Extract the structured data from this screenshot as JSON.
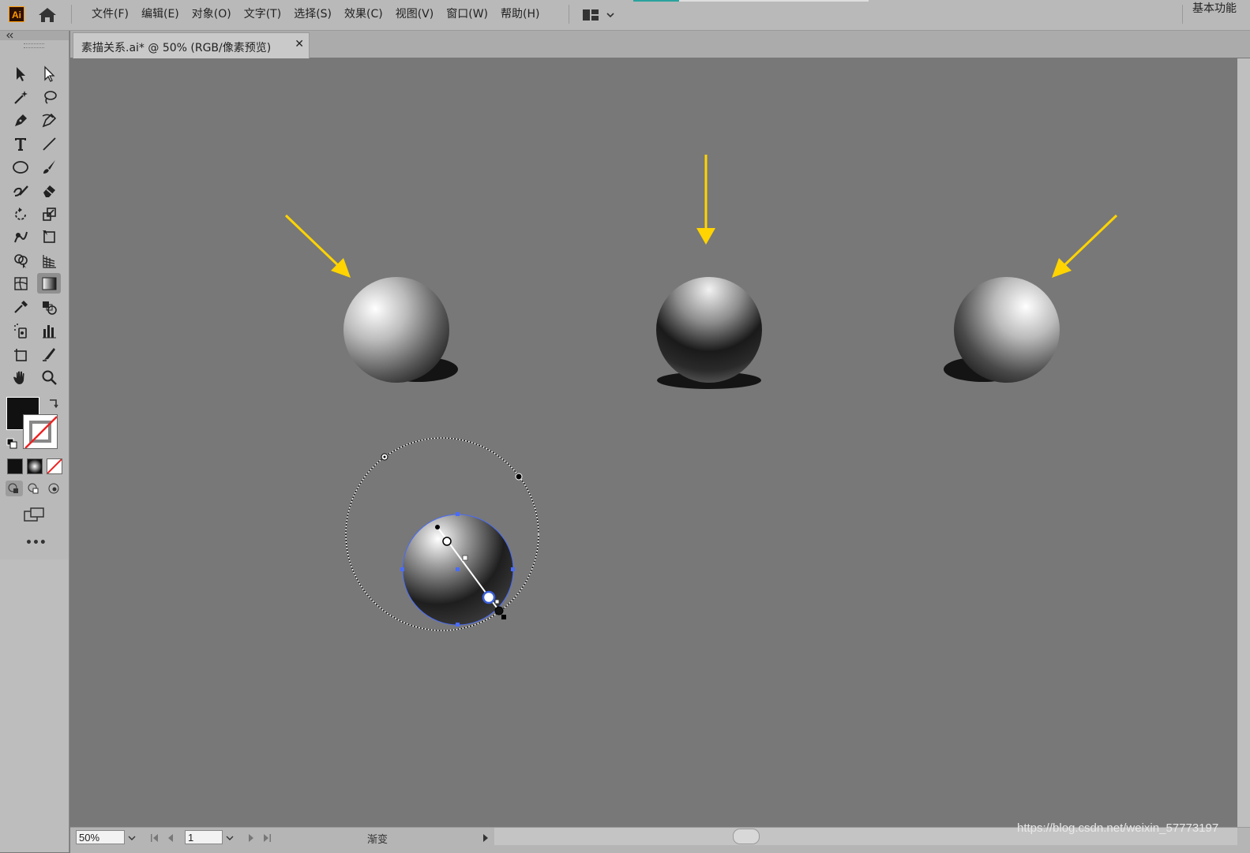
{
  "app": {
    "logo": "Ai",
    "menu": [
      "文件(F)",
      "编辑(E)",
      "对象(O)",
      "文字(T)",
      "选择(S)",
      "效果(C)",
      "视图(V)",
      "窗口(W)",
      "帮助(H)"
    ],
    "workspace_label": "基本功能"
  },
  "document": {
    "tab_title": "素描关系.ai* @ 50% (RGB/像素预览)",
    "close": "✕"
  },
  "tools": [
    "selection-tool",
    "direct-selection-tool",
    "magic-wand-tool",
    "lasso-tool",
    "pen-tool",
    "curvature-tool",
    "type-tool",
    "line-segment-tool",
    "ellipse-tool",
    "paintbrush-tool",
    "shaper-tool",
    "eraser-tool",
    "rotate-tool",
    "scale-tool",
    "warp-tool",
    "free-transform-tool",
    "shape-builder-tool",
    "perspective-grid-tool",
    "mesh-tool",
    "gradient-tool",
    "eyedropper-tool",
    "blend-tool",
    "symbol-sprayer-tool",
    "column-graph-tool",
    "artboard-tool",
    "slice-tool",
    "hand-tool",
    "zoom-tool"
  ],
  "active_tool": "gradient-tool",
  "colors": {
    "fill": "#111111",
    "stroke": "none",
    "arrow": "#ffd400",
    "canvas": "#787878",
    "selection": "#4a6cf7"
  },
  "more_tools_label": "•••",
  "status": {
    "zoom": "50%",
    "page": "1",
    "label": "渐变"
  },
  "watermark": "https://blog.csdn.net/weixin_57773197"
}
